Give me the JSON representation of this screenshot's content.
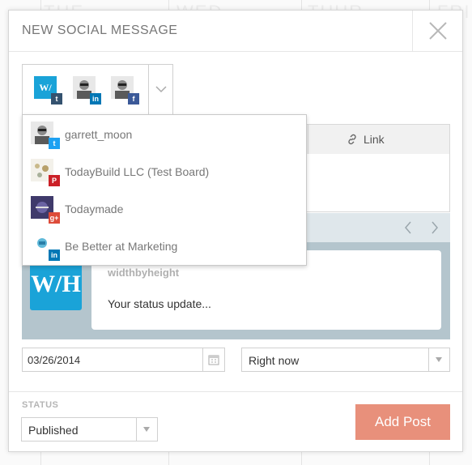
{
  "background_calendar": {
    "day_headers": [
      "THE",
      "WED",
      "THUR",
      "FRI"
    ]
  },
  "modal": {
    "title": "NEW SOCIAL MESSAGE",
    "close_icon": "close-icon"
  },
  "account_selector": {
    "selected": [
      {
        "account": "widthbyheight",
        "logo_text": "W/",
        "network": "tumblr",
        "badge": "t",
        "badge_color": "#34526f"
      },
      {
        "account": "garrett_moon",
        "network": "linkedin",
        "badge": "in",
        "badge_color": "#0077b5"
      },
      {
        "account": "garrett_moon",
        "network": "facebook",
        "badge": "f",
        "badge_color": "#3b5998"
      }
    ],
    "toggle_icon": "chevron-down-icon"
  },
  "account_menu": {
    "items": [
      {
        "label": "garrett_moon",
        "network": "twitter",
        "badge": "t",
        "badge_color": "#1da1f2"
      },
      {
        "label": "TodayBuild LLC (Test Board)",
        "network": "pinterest",
        "badge": "P",
        "badge_color": "#cb2027"
      },
      {
        "label": "Todaymade",
        "network": "google-plus",
        "badge": "g+",
        "badge_color": "#dd4b39"
      },
      {
        "label": "Be Better at Marketing",
        "network": "linkedin",
        "badge": "in",
        "badge_color": "#0077b5"
      }
    ]
  },
  "composer": {
    "link_tab_label": "Link",
    "link_icon": "link-icon"
  },
  "preview": {
    "prev_icon": "chevron-left-icon",
    "next_icon": "chevron-right-icon",
    "logo_text": "W/H",
    "account_name": "widthbyheight",
    "status_text": "Your status update..."
  },
  "schedule": {
    "date_value": "03/26/2014",
    "calendar_icon": "calendar-icon",
    "time_value": "Right now"
  },
  "footer": {
    "status_label": "STATUS",
    "status_value": "Published",
    "add_post_label": "Add Post"
  },
  "colors": {
    "accent": "#e8907b",
    "brand_blue": "#1aa3d8",
    "preview_bg": "#b4c5cd"
  }
}
